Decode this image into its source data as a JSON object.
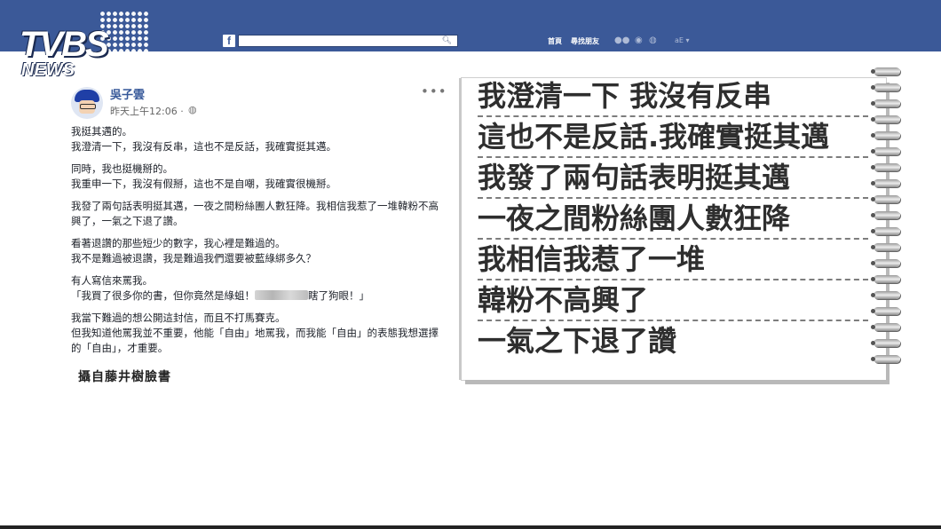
{
  "brand": {
    "logo_main": "TVBS",
    "logo_sub": "NEWS"
  },
  "topbar": {
    "fb_logo": "f",
    "search_placeholder": "",
    "nav_home": "首頁",
    "nav_find_friends": "尋找朋友",
    "account_short": "aE"
  },
  "post": {
    "author": "吳子雲",
    "timestamp": "昨天上午12:06 ·",
    "paragraphs": [
      [
        "我挺其邁的。",
        "我澄清一下，我沒有反串，這也不是反話，我確實挺其邁。"
      ],
      [
        "同時，我也挺機掰的。",
        "我重申一下，我沒有假掰，這也不是自嘲，我確實很機掰。"
      ],
      [
        "我發了兩句話表明挺其邁，一夜之間粉絲團人數狂降。我相信我惹了一堆韓粉不高興了，一氣之下退了讚。"
      ],
      [
        "看著退讚的那些短少的數字，我心裡是難過的。",
        "我不是難過被退讚，我是難過我們還要被藍綠綁多久？"
      ],
      [
        "有人寫信來罵我。"
      ],
      [
        "我當下難過的想公開這封信，而且不打馬賽克。",
        "但我知道他罵我並不重要，他能「自由」地罵我，而我能「自由」的表態我想選擇的「自由」，才重要。"
      ]
    ],
    "quote_start": "「我買了很多你的書，但你竟然是綠蛆！",
    "quote_end": "瞎了狗眼！」"
  },
  "credit": "攝自藤井樹臉書",
  "notebook": {
    "lines": [
      "我澄清一下 我沒有反串",
      "這也不是反話.我確實挺其邁",
      "我發了兩句話表明挺其邁",
      "一夜之間粉絲團人數狂降",
      "我相信我惹了一堆",
      "韓粉不高興了",
      "一氣之下退了讚"
    ]
  },
  "colors": {
    "fb_blue": "#3b5998",
    "link_blue": "#365899"
  }
}
